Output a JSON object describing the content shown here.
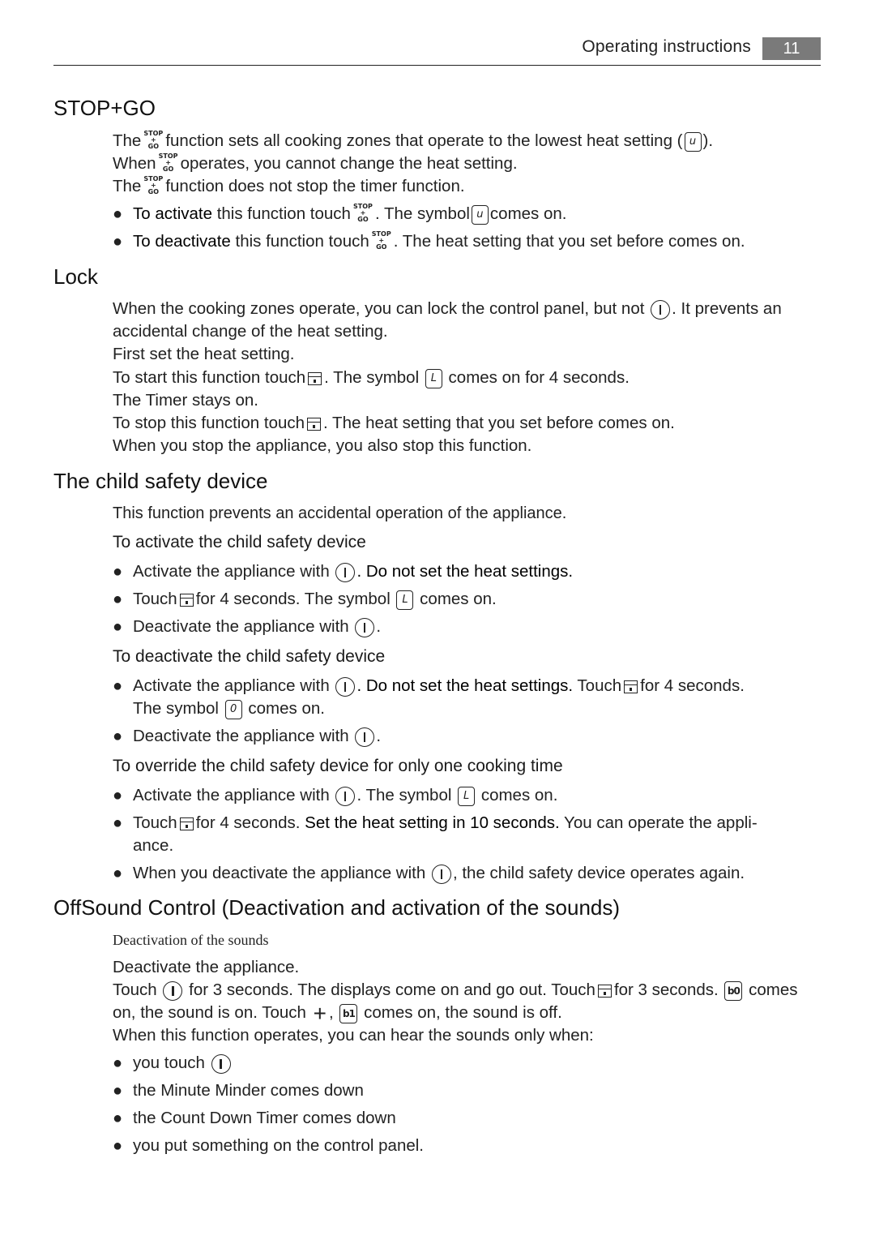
{
  "header": {
    "title": "Operating instructions",
    "page_number": "11"
  },
  "icons": {
    "stop_go": "stop-go-icon (STOP + GO)",
    "symbol_u": "u",
    "symbol_l": "L",
    "symbol_0": "0",
    "symbol_b0": "b0",
    "symbol_b1": "b1",
    "power": "power-icon",
    "lock": "lock-icon",
    "plus": "+"
  },
  "stopgo_label": {
    "stop": "STOP",
    "plus": "+",
    "go": "GO"
  },
  "sections": {
    "stopgo": {
      "title": "STOP+GO",
      "p1a": "The",
      "p1b": "function sets all cooking zones that operate to the lowest heat setting (",
      "p1c": ").",
      "p2a": "When",
      "p2b": "operates, you cannot change the heat setting.",
      "p3a": "The",
      "p3b": "function does not stop the timer function.",
      "b1a": "To activate",
      "b1b": " this function touch",
      "b1c": ". The symbol",
      "b1d": "comes on.",
      "b2a": "To deactivate",
      "b2b": " this function touch",
      "b2c": ". The heat setting that you set before comes on."
    },
    "lock": {
      "title": "Lock",
      "l1a": "When the cooking zones operate, you can lock the control panel, but not",
      "l1b": ". It prevents an",
      "l2": "accidental change of the heat setting.",
      "l3": "First set the heat setting.",
      "l4a": "To start this function touch",
      "l4b": ". The symbol",
      "l4c": "comes on for 4 seconds.",
      "l5": "The Timer stays on.",
      "l6a": "To stop this function touch",
      "l6b": ". The heat setting that you set before comes on.",
      "l7": "When you stop the appliance, you also stop this function."
    },
    "child": {
      "title": "The child safety device",
      "intro": "This function prevents an accidental operation of the appliance.",
      "activate_heading": "To activate the child safety device",
      "a1a": "Activate the appliance with",
      "a1b": ". Do not set the heat settings.",
      "a2a": "Touch",
      "a2b": "for 4 seconds. The symbol",
      "a2c": "comes on.",
      "a3a": "Deactivate the appliance with",
      "a3b": ".",
      "deactivate_heading": "To deactivate the child safety device",
      "d1a": "Activate the appliance with",
      "d1b": ". Do not set the heat settings.",
      "d1c": " Touch",
      "d1d": "for 4 seconds.",
      "d1e": "The symbol",
      "d1f": "comes on.",
      "d2a": "Deactivate the appliance with",
      "d2b": ".",
      "override_heading": "To override the child safety device for only one cooking time",
      "o1a": "Activate the appliance with",
      "o1b": ". The symbol",
      "o1c": "comes on.",
      "o2a": "Touch",
      "o2b": "for 4 seconds.",
      "o2c": " Set the heat setting in 10 seconds.",
      "o2d": " You can operate the appli-",
      "o2e": "ance.",
      "o3a": "When you deactivate the appliance with",
      "o3b": ", the child safety device operates again."
    },
    "offsound": {
      "title": "OffSound Control (Deactivation and activation of the sounds)",
      "subheading": "Deactivation of the sounds",
      "s1": "Deactivate the appliance.",
      "s2a": "Touch",
      "s2b": "for 3 seconds. The displays come on and go out. Touch",
      "s2c": "for 3 seconds.",
      "s2d": "comes",
      "s3a": "on, the sound is on. Touch",
      "s3b": ",",
      "s3c": "comes on, the sound is off.",
      "s4": "When this function operates, you can hear the sounds only when:",
      "bullets": [
        "you touch",
        "the Minute Minder comes down",
        "the Count Down Timer comes down",
        "you put something on the control panel."
      ]
    }
  }
}
